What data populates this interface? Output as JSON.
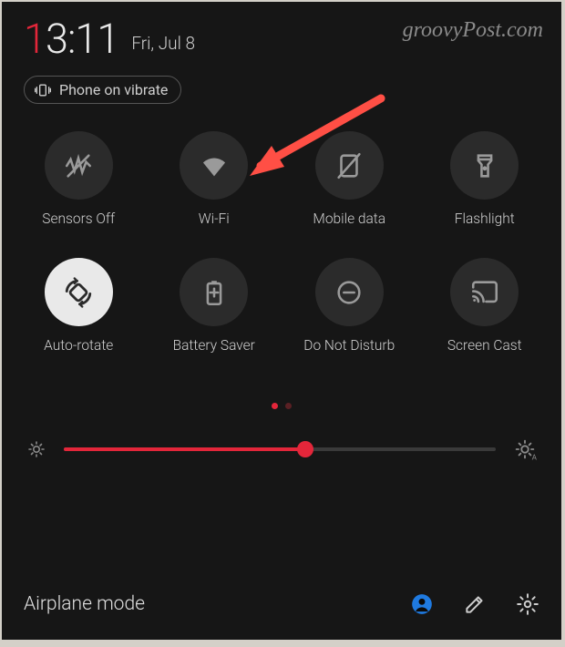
{
  "watermark": "groovyPost.com",
  "clock": {
    "hour_lead": "1",
    "hour_trail": "3",
    "sep": ":",
    "minutes": "11"
  },
  "date": "Fri, Jul 8",
  "vibrate_chip": "Phone on vibrate",
  "tiles": [
    {
      "id": "sensors-off",
      "label": "Sensors Off",
      "icon": "sensors-off-icon",
      "active": false
    },
    {
      "id": "wifi",
      "label": "Wi-Fi",
      "icon": "wifi-icon",
      "active": false
    },
    {
      "id": "mobile-data",
      "label": "Mobile data",
      "icon": "mobile-data-icon",
      "active": false
    },
    {
      "id": "flashlight",
      "label": "Flashlight",
      "icon": "flashlight-icon",
      "active": false
    },
    {
      "id": "auto-rotate",
      "label": "Auto-rotate",
      "icon": "auto-rotate-icon",
      "active": true
    },
    {
      "id": "battery-saver",
      "label": "Battery Saver",
      "icon": "battery-saver-icon",
      "active": false
    },
    {
      "id": "dnd",
      "label": "Do Not Disturb",
      "icon": "dnd-icon",
      "active": false
    },
    {
      "id": "screen-cast",
      "label": "Screen Cast",
      "icon": "screen-cast-icon",
      "active": false
    }
  ],
  "pager": {
    "count": 2,
    "current": 0
  },
  "brightness": {
    "percent": 56
  },
  "airplane_label": "Airplane mode",
  "colors": {
    "accent": "#e3263a",
    "bg": "#161616",
    "tile": "#2b2b2b",
    "active_tile": "#e9e9e9"
  },
  "arrow_target": "wifi"
}
